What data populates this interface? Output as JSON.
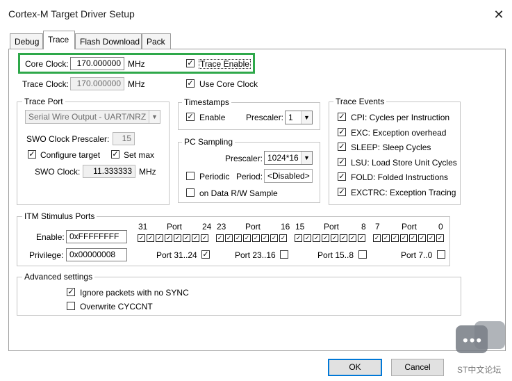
{
  "window": {
    "title": "Cortex-M Target Driver Setup",
    "close_glyph": "✕"
  },
  "tabs": [
    {
      "label": "Debug"
    },
    {
      "label": "Trace"
    },
    {
      "label": "Flash Download"
    },
    {
      "label": "Pack"
    }
  ],
  "clock": {
    "core_label": "Core Clock:",
    "core_value": "170.000000",
    "core_unit": "MHz",
    "trace_enable_label": "Trace Enable",
    "trace_enable_checked": true,
    "trace_label": "Trace Clock:",
    "trace_value": "170.000000",
    "trace_unit": "MHz",
    "use_core_label": "Use Core Clock",
    "use_core_checked": true
  },
  "trace_port": {
    "title": "Trace Port",
    "select_value": "Serial Wire Output - UART/NRZ",
    "prescaler_label": "SWO Clock Prescaler:",
    "prescaler_value": "15",
    "configure_label": "Configure target",
    "configure_checked": true,
    "setmax_label": "Set max",
    "setmax_checked": true,
    "swo_label": "SWO Clock:",
    "swo_value": "11.333333",
    "swo_unit": "MHz"
  },
  "timestamps": {
    "title": "Timestamps",
    "enable_label": "Enable",
    "enable_checked": true,
    "prescaler_label": "Prescaler:",
    "prescaler_value": "1"
  },
  "pc_sampling": {
    "title": "PC Sampling",
    "prescaler_label": "Prescaler:",
    "prescaler_value": "1024*16",
    "periodic_label": "Periodic",
    "periodic_checked": false,
    "period_label": "Period:",
    "period_value": "<Disabled>",
    "data_rw_label": "on Data R/W Sample",
    "data_rw_checked": false
  },
  "trace_events": {
    "title": "Trace Events",
    "items": [
      {
        "label": "CPI: Cycles per Instruction",
        "checked": true
      },
      {
        "label": "EXC: Exception overhead",
        "checked": true
      },
      {
        "label": "SLEEP: Sleep Cycles",
        "checked": true
      },
      {
        "label": "LSU: Load Store Unit Cycles",
        "checked": true
      },
      {
        "label": "FOLD: Folded Instructions",
        "checked": true
      },
      {
        "label": "EXCTRC: Exception Tracing",
        "checked": true
      }
    ]
  },
  "itm": {
    "title": "ITM Stimulus Ports",
    "enable_label": "Enable:",
    "enable_value": "0xFFFFFFFF",
    "privilege_label": "Privilege:",
    "privilege_value": "0x00000008",
    "header_numbers": [
      "31",
      "24",
      "23",
      "16",
      "15",
      "8",
      "7",
      "0"
    ],
    "header_port": "Port",
    "privilege_groups": [
      {
        "label": "Port 31..24",
        "checked": true
      },
      {
        "label": "Port 23..16",
        "checked": false
      },
      {
        "label": "Port 15..8",
        "checked": false
      },
      {
        "label": "Port 7..0",
        "checked": false
      }
    ]
  },
  "advanced": {
    "title": "Advanced settings",
    "ignore_label": "Ignore packets with no SYNC",
    "ignore_checked": true,
    "overwrite_label": "Overwrite CYCCNT",
    "overwrite_checked": false
  },
  "buttons": {
    "ok": "OK",
    "cancel": "Cancel"
  },
  "watermark": {
    "text": "ST中文论坛"
  },
  "colors": {
    "highlight": "#2ea84a",
    "default_button_border": "#0078d7"
  },
  "icons": {
    "check": "✓",
    "dropdown": "▼"
  }
}
